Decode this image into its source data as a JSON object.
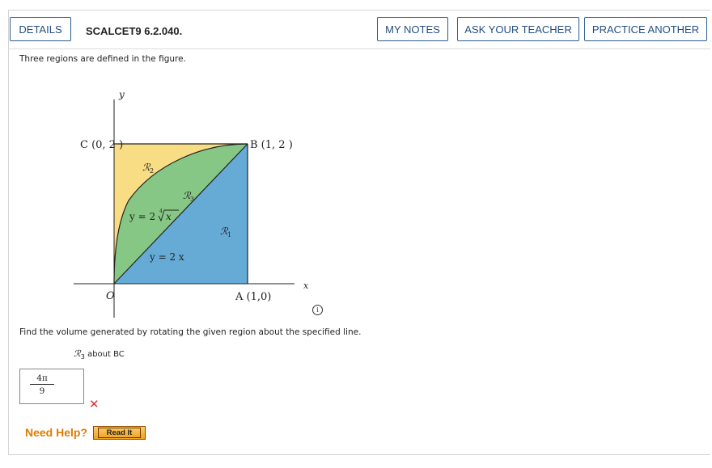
{
  "header": {
    "details_label": "DETAILS",
    "question_id": "SCALCET9 6.2.040.",
    "my_notes_label": "MY NOTES",
    "ask_teacher_label": "ASK YOUR TEACHER",
    "practice_another_label": "PRACTICE ANOTHER"
  },
  "question": {
    "intro": "Three regions are defined in the figure.",
    "prompt": "Find the volume generated by rotating the given region about the specified line.",
    "region_symbol": "ℛ",
    "region_sub": "3",
    "region_suffix": "about BC"
  },
  "figure": {
    "y_axis": "y",
    "x_axis": "x",
    "origin": "O",
    "point_c": "C (0, 2 )",
    "point_b": "B (1, 2 )",
    "point_a": "A (1,0)",
    "region_2": "ℛ",
    "region_2_sub": "2",
    "region_3": "ℛ",
    "region_3_sub": "3",
    "region_1": "ℛ",
    "region_1_sub": "1",
    "curve_label_prefix": "y = 2",
    "curve_label_root_index": "4",
    "curve_label_var": "x",
    "line_label": "y = 2 x",
    "colors": {
      "yellow": "#f9dd84",
      "green": "#86c786",
      "blue": "#66aad6"
    }
  },
  "answer": {
    "numerator": "4π",
    "denominator": "9",
    "status_icon": "x-mark-icon",
    "status_color": "#d9342b"
  },
  "help": {
    "need_help_label": "Need Help?",
    "read_it_label": "Read It"
  }
}
